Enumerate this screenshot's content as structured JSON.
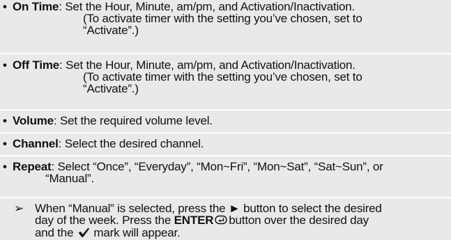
{
  "items": [
    {
      "bullet": "•",
      "term": "On Time",
      "line1": ": Set the Hour, Minute, am/pm, and Activation/Inactivation.",
      "line2": "(To activate timer with the setting you’ve chosen, set to",
      "line3": "“Activate”.)"
    },
    {
      "bullet": "•",
      "term": "Off Time",
      "line1": ": Set the Hour, Minute, am/pm, and Activation/Inactivation.",
      "line2": "(To activate timer with the setting you’ve chosen, set to",
      "line3": "“Activate”.)"
    },
    {
      "bullet": "•",
      "term": "Volume",
      "line1": ": Set the required volume level."
    },
    {
      "bullet": "•",
      "term": "Channel",
      "line1": ": Select the desired channel."
    },
    {
      "bullet": "•",
      "term": "Repeat",
      "line1": ": Select “Once”, “Everyday”, “Mon~Fri”, “Mon~Sat”, “Sat~Sun”, or",
      "line2": "“Manual”."
    }
  ],
  "note": {
    "icon": "➢",
    "line1_a": "When “Manual” is selected, press the",
    "play_symbol": "►",
    "line1_b": "button to select the desired",
    "line2_a": "day of the week. Press the",
    "enter_label": "ENTER",
    "line2_b": "button over the desired day",
    "line3_a": "and the",
    "line3_b": "mark will appear."
  },
  "colors": {
    "background": "#e9e9ea",
    "text": "#111111",
    "divider": "#ffffff"
  },
  "icons": {
    "bullet": "bullet-icon",
    "note_arrow": "arrowhead-icon",
    "play": "play-icon",
    "enter": "enter-icon",
    "check": "checkmark-icon"
  }
}
